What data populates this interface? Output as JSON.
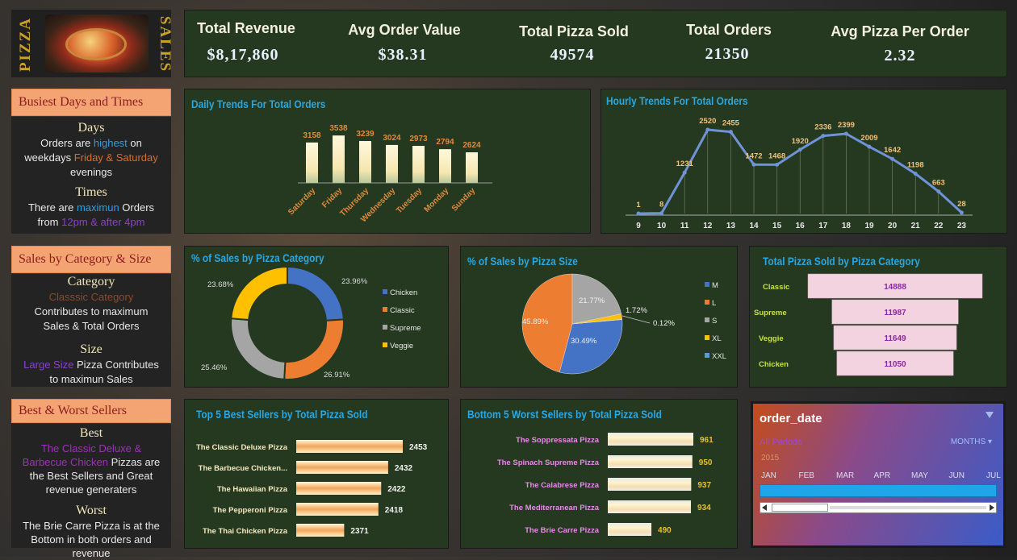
{
  "logo": {
    "left_text": "PIZZA",
    "right_text": "SALES"
  },
  "kpis": [
    {
      "label": "Total Revenue",
      "value": "$8,17,860"
    },
    {
      "label": "Avg Order Value",
      "value": "$38.31"
    },
    {
      "label": "Total Pizza Sold",
      "value": "49574"
    },
    {
      "label": "Total Orders",
      "value": "21350"
    },
    {
      "label": "Avg Pizza Per Order",
      "value": "2.32"
    }
  ],
  "side": {
    "s1": {
      "head": "Busiest Days and Times",
      "days_h": "Days",
      "days_a": "Orders are ",
      "days_b": "highest",
      "days_c": " on",
      "days_d": "weekdays ",
      "days_e": "Friday & Saturday",
      "days_f": "evenings",
      "times_h": "Times",
      "times_a": "There are ",
      "times_b": "maximun",
      "times_c": " Orders",
      "times_d": "from ",
      "times_e": "12pm & after 4pm"
    },
    "s2": {
      "head": "Sales by Category & Size",
      "cat_h": "Category",
      "cat_a": "Classsic Category",
      "cat_b": "Contributes to maximum",
      "cat_c": "Sales & Total Orders",
      "size_h": "Size",
      "size_a": "Large Size",
      "size_b": " Pizza Contributes",
      "size_c": "to maximun Sales"
    },
    "s3": {
      "head": "Best & Worst Sellers",
      "best_h": "Best",
      "best_a": "The Classic Deluxe &",
      "best_b": "Barbecue Chicken",
      "best_c": " Pizzas are",
      "best_d": "the Best Sellers and Great",
      "best_e": "revenue generaters",
      "worst_h": "Worst",
      "worst_a": "The Brie Carre Pizza is at the",
      "worst_b": "Bottom in both orders and revenue"
    }
  },
  "titles": {
    "daily": "Daily Trends For Total Orders",
    "hourly": "Hourly Trends For Total Orders",
    "cat": "%  of Sales by Pizza Category",
    "size": "% of Sales by Pizza Size",
    "sold": "Total Pizza Sold by Pizza Category",
    "top5": "Top 5 Best Sellers by Total Pizza Sold",
    "bottom5": "Bottom 5 Worst Sellers by Total  Pizza Sold"
  },
  "slicer": {
    "title": "order_date",
    "all_periods": "All Periods",
    "months": "MONTHS",
    "year": "2015",
    "month_labels": [
      "JAN",
      "FEB",
      "MAR",
      "APR",
      "MAY",
      "JUN",
      "JUL"
    ]
  },
  "chart_data": [
    {
      "id": "daily",
      "type": "bar",
      "title": "Daily Trends For Total Orders",
      "categories": [
        "Saturday",
        "Friday",
        "Thursday",
        "Wednesday",
        "Tuesday",
        "Monday",
        "Sunday"
      ],
      "values": [
        3158,
        3538,
        3239,
        3024,
        2973,
        2794,
        2624
      ],
      "colors": {
        "bar": "#f6ecc2",
        "label": "#e08a3a"
      }
    },
    {
      "id": "hourly",
      "type": "line",
      "title": "Hourly Trends For Total Orders",
      "x": [
        9,
        10,
        11,
        12,
        13,
        14,
        15,
        16,
        17,
        18,
        19,
        20,
        21,
        22,
        23
      ],
      "values": [
        1,
        8,
        1231,
        2520,
        2455,
        1472,
        1468,
        1920,
        2336,
        2399,
        2009,
        1642,
        1198,
        663,
        28
      ],
      "colors": {
        "line": "#6f93d6",
        "label": "#f0c27a"
      }
    },
    {
      "id": "category",
      "type": "pie",
      "title": "%  of Sales by Pizza Category",
      "labels": [
        "Chicken",
        "Classic",
        "Supreme",
        "Veggie"
      ],
      "values": [
        23.96,
        26.91,
        25.46,
        23.68
      ],
      "value_labels": [
        "23.96%",
        "26.91%",
        "25.46%",
        "23.68%"
      ],
      "colors": [
        "#4472c4",
        "#ed7d31",
        "#a5a5a5",
        "#ffc000"
      ]
    },
    {
      "id": "size",
      "type": "pie",
      "title": "% of Sales by Pizza Size",
      "labels": [
        "M",
        "L",
        "S",
        "XL",
        "XXL"
      ],
      "values": [
        30.49,
        45.89,
        21.77,
        1.72,
        0.12
      ],
      "value_labels": [
        "30.49%",
        "45.89%",
        "21.77%",
        "1.72%",
        "0.12%"
      ],
      "colors": [
        "#4472c4",
        "#ed7d31",
        "#a5a5a5",
        "#ffc000",
        "#5b9bd5"
      ]
    },
    {
      "id": "sold",
      "type": "bar",
      "title": "Total Pizza Sold by Pizza Category",
      "categories": [
        "Classic",
        "Supreme",
        "Veggie",
        "Chicken"
      ],
      "values": [
        14888,
        11987,
        11649,
        11050
      ],
      "colors": {
        "bar": "#f3d3df",
        "label": "#8a2aa0",
        "category": "#c8e04a"
      }
    },
    {
      "id": "top5",
      "type": "bar",
      "title": "Top 5 Best Sellers by Total Pizza Sold",
      "categories": [
        "The Classic Deluxe Pizza",
        "The Barbecue Chicken...",
        "The Hawaiian Pizza",
        "The Pepperoni Pizza",
        "The Thai Chicken Pizza"
      ],
      "values": [
        2453,
        2432,
        2422,
        2418,
        2371
      ],
      "colors": {
        "bar": "#f2a65a",
        "category": "#f5e9c0"
      }
    },
    {
      "id": "bottom5",
      "type": "bar",
      "title": "Bottom 5 Worst Sellers by Total  Pizza Sold",
      "categories": [
        "The Soppressata Pizza",
        "The Spinach Supreme Pizza",
        "The Calabrese Pizza",
        "The Mediterranean Pizza",
        "The Brie Carre Pizza"
      ],
      "values": [
        961,
        950,
        937,
        934,
        490
      ],
      "colors": {
        "bar": "#f4e4c4",
        "label": "#e8c02a",
        "category": "#e88ae8"
      }
    }
  ]
}
